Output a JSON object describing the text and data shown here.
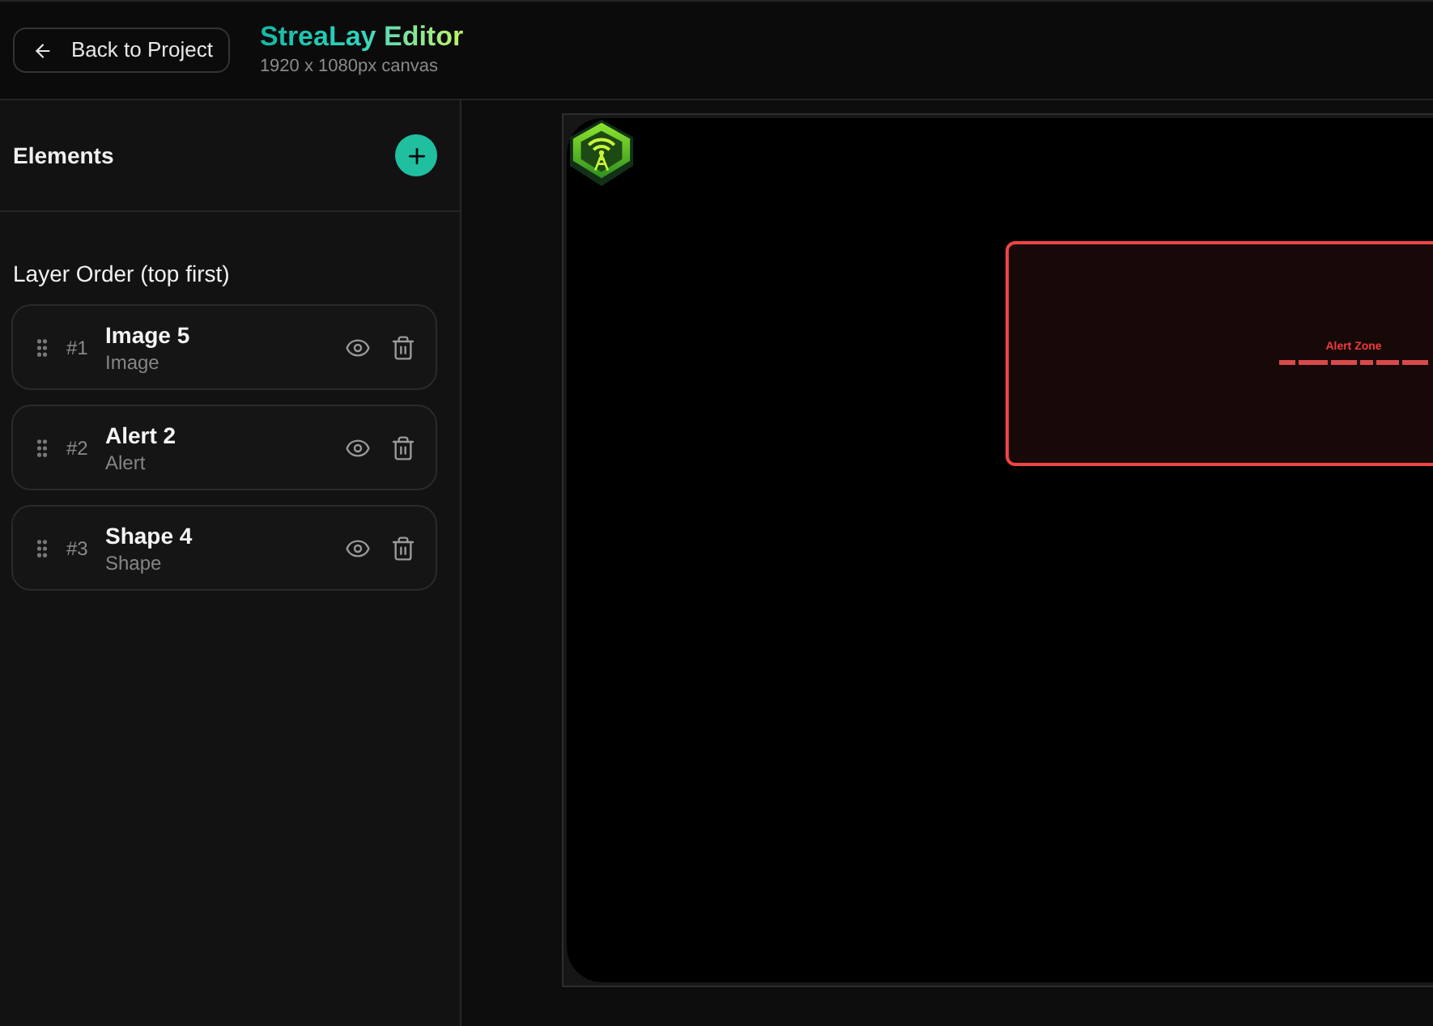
{
  "header": {
    "back_button": "Back to Project",
    "title": "StreaLay Editor",
    "subtitle": "1920 x 1080px canvas"
  },
  "sidebar": {
    "heading": "Elements",
    "section_title": "Layer Order (top first)",
    "layers": [
      {
        "index": "#1",
        "name": "Image 5",
        "type": "Image",
        "visible": true
      },
      {
        "index": "#2",
        "name": "Alert 2",
        "type": "Alert",
        "visible": true
      },
      {
        "index": "#3",
        "name": "Shape 4",
        "type": "Shape",
        "visible": true
      }
    ]
  },
  "canvas": {
    "elements": [
      {
        "kind": "image"
      },
      {
        "kind": "alert",
        "title": "Alert Zone"
      }
    ]
  }
}
